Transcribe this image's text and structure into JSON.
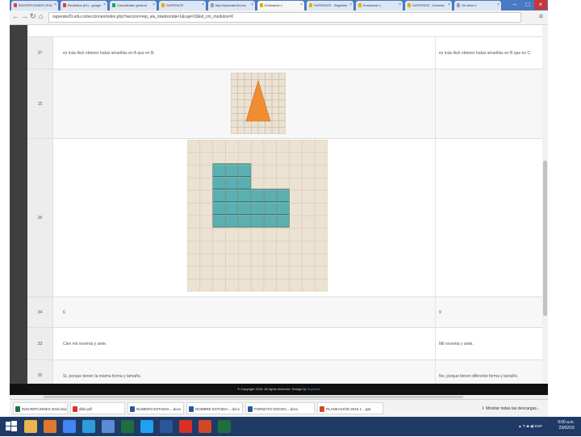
{
  "browser": {
    "tabs": [
      {
        "label": "INSCRIPCIONES 2016",
        "icon": "gmail-icon",
        "color": "#d44638"
      },
      {
        "label": "Recibidos (61) - google",
        "icon": "gmail-icon",
        "color": "#d44638"
      },
      {
        "label": "Consolidado general",
        "icon": "sheets-icon",
        "color": "#1fa463"
      },
      {
        "label": "SUPERATE",
        "icon": "superate-icon",
        "color": "#e2b000"
      },
      {
        "label": "http://superate20.edu",
        "icon": "page-icon",
        "color": "#9aa0a6"
      },
      {
        "label": "Evaluación | ",
        "icon": "superate-icon",
        "color": "#e2b000"
      },
      {
        "label": "SUPERATE - Seguimie",
        "icon": "superate-icon",
        "color": "#e2b000"
      },
      {
        "label": "Evaluación | ",
        "icon": "superate-icon",
        "color": "#e2b000"
      },
      {
        "label": "SUPERATE - Docente",
        "icon": "superate-icon",
        "color": "#e2b000"
      },
      {
        "label": "Sin título 1",
        "icon": "page-icon",
        "color": "#9aa0a6"
      }
    ],
    "active_tab": 5,
    "url": "superate20.edu.co/secciones/index.php?seccion=rep_alu_lote&ronda=1&cap=18&id_cm_modulos=0"
  },
  "rows": [
    {
      "num": "37",
      "left": "es más fácil obtener todas amarillas en A que en B.",
      "right": "es más fácil obtener todas amarillas en B que en C."
    },
    {
      "num": "15",
      "left": "",
      "right": ""
    },
    {
      "num": "35",
      "left": "",
      "right": ""
    },
    {
      "num": "34",
      "left": "6",
      "right": "9"
    },
    {
      "num": "33",
      "left": "Cien mil noventa y siete.",
      "right": "Mil noventa y siete."
    },
    {
      "num": "32",
      "left": "Sí, porque tienen la misma forma y tamaño.",
      "right": "No, porque tienen diferente forma y tamaño."
    }
  ],
  "figures": {
    "triangle": {
      "color": "#f08c32",
      "grid_color": "#b7a99a",
      "bg": "#ece2d2"
    },
    "lshape": {
      "color": "#5aafb0",
      "grid_color": "#c9b9a3",
      "bg": "#ece2d2",
      "cells": [
        [
          3,
          2
        ],
        [
          4,
          2
        ],
        [
          5,
          2
        ],
        [
          3,
          3
        ],
        [
          4,
          3
        ],
        [
          5,
          3
        ],
        [
          3,
          4
        ],
        [
          4,
          4
        ],
        [
          5,
          4
        ],
        [
          6,
          4
        ],
        [
          7,
          4
        ],
        [
          8,
          4
        ],
        [
          3,
          5
        ],
        [
          4,
          5
        ],
        [
          5,
          5
        ],
        [
          6,
          5
        ],
        [
          7,
          5
        ],
        [
          8,
          5
        ],
        [
          3,
          6
        ],
        [
          4,
          6
        ],
        [
          5,
          6
        ],
        [
          6,
          6
        ],
        [
          7,
          6
        ],
        [
          8,
          6
        ]
      ]
    }
  },
  "footer": "© Copyright 2016. All rights reserved. Design by",
  "footer_brand": "Superate",
  "downloads": [
    {
      "label": "INSCRIPCIONES 2016.xlsx",
      "icon": "excel-icon",
      "color": "#1d6f42"
    },
    {
      "label": "dibir.pdf",
      "icon": "pdf-icon",
      "color": "#d93025"
    },
    {
      "label": "NÚMERO ESTUDIA....docx",
      "icon": "word-icon",
      "color": "#2b579a"
    },
    {
      "label": "NOMBRE ESTUDIA....docx",
      "icon": "word-icon",
      "color": "#2b579a"
    },
    {
      "label": "FORMATO DOCEN....docx",
      "icon": "word-icon",
      "color": "#2b579a"
    },
    {
      "label": "PLANEACIÓN 2016 1....ppt",
      "icon": "ppt-icon",
      "color": "#d24726"
    }
  ],
  "downloads_all": "Mostrar todas las descargas...",
  "tray": {
    "time": "9:00 a.m.",
    "date": "23/02/16",
    "lang": "ESP"
  }
}
